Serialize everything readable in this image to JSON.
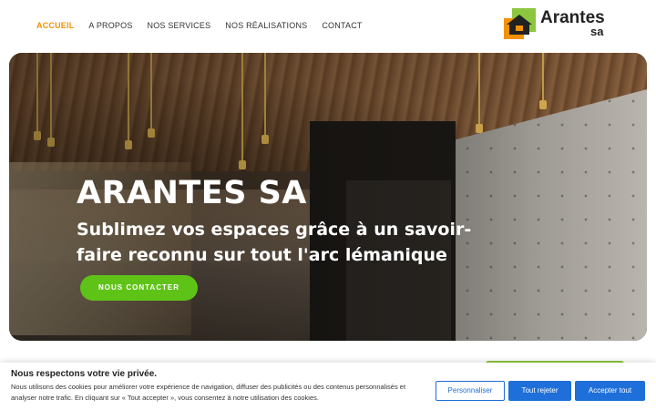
{
  "nav": {
    "items": [
      {
        "label": "ACCUEIL",
        "active": true
      },
      {
        "label": "A PROPOS",
        "active": false
      },
      {
        "label": "NOS SERVICES",
        "active": false
      },
      {
        "label": "NOS RÉALISATIONS",
        "active": false
      },
      {
        "label": "CONTACT",
        "active": false
      }
    ],
    "active_color": "#f39200"
  },
  "logo": {
    "line1": "Arantes",
    "line2": "sa",
    "icon": "house-logo-icon",
    "colors": {
      "green": "#8cc63f",
      "orange": "#f39200"
    }
  },
  "hero": {
    "title": "ARANTES SA",
    "subtitle": "Sublimez vos espaces grâce à un savoir-faire reconnu sur tout l'arc lémanique",
    "cta_label": "NOUS CONTACTER",
    "cta_color": "#5fc317"
  },
  "cookie_banner": {
    "title": "Nous respectons votre vie privée.",
    "text": "Nous utilisons des cookies pour améliorer votre expérience de navigation, diffuser des publicités ou des contenus personnalisés et analyser notre trafic. En cliquant sur « Tout accepter », vous consentez à notre utilisation des cookies.",
    "customize_label": "Personnaliser",
    "reject_label": "Tout rejeter",
    "accept_label": "Accepter tout",
    "button_color": "#1e6fd9"
  }
}
